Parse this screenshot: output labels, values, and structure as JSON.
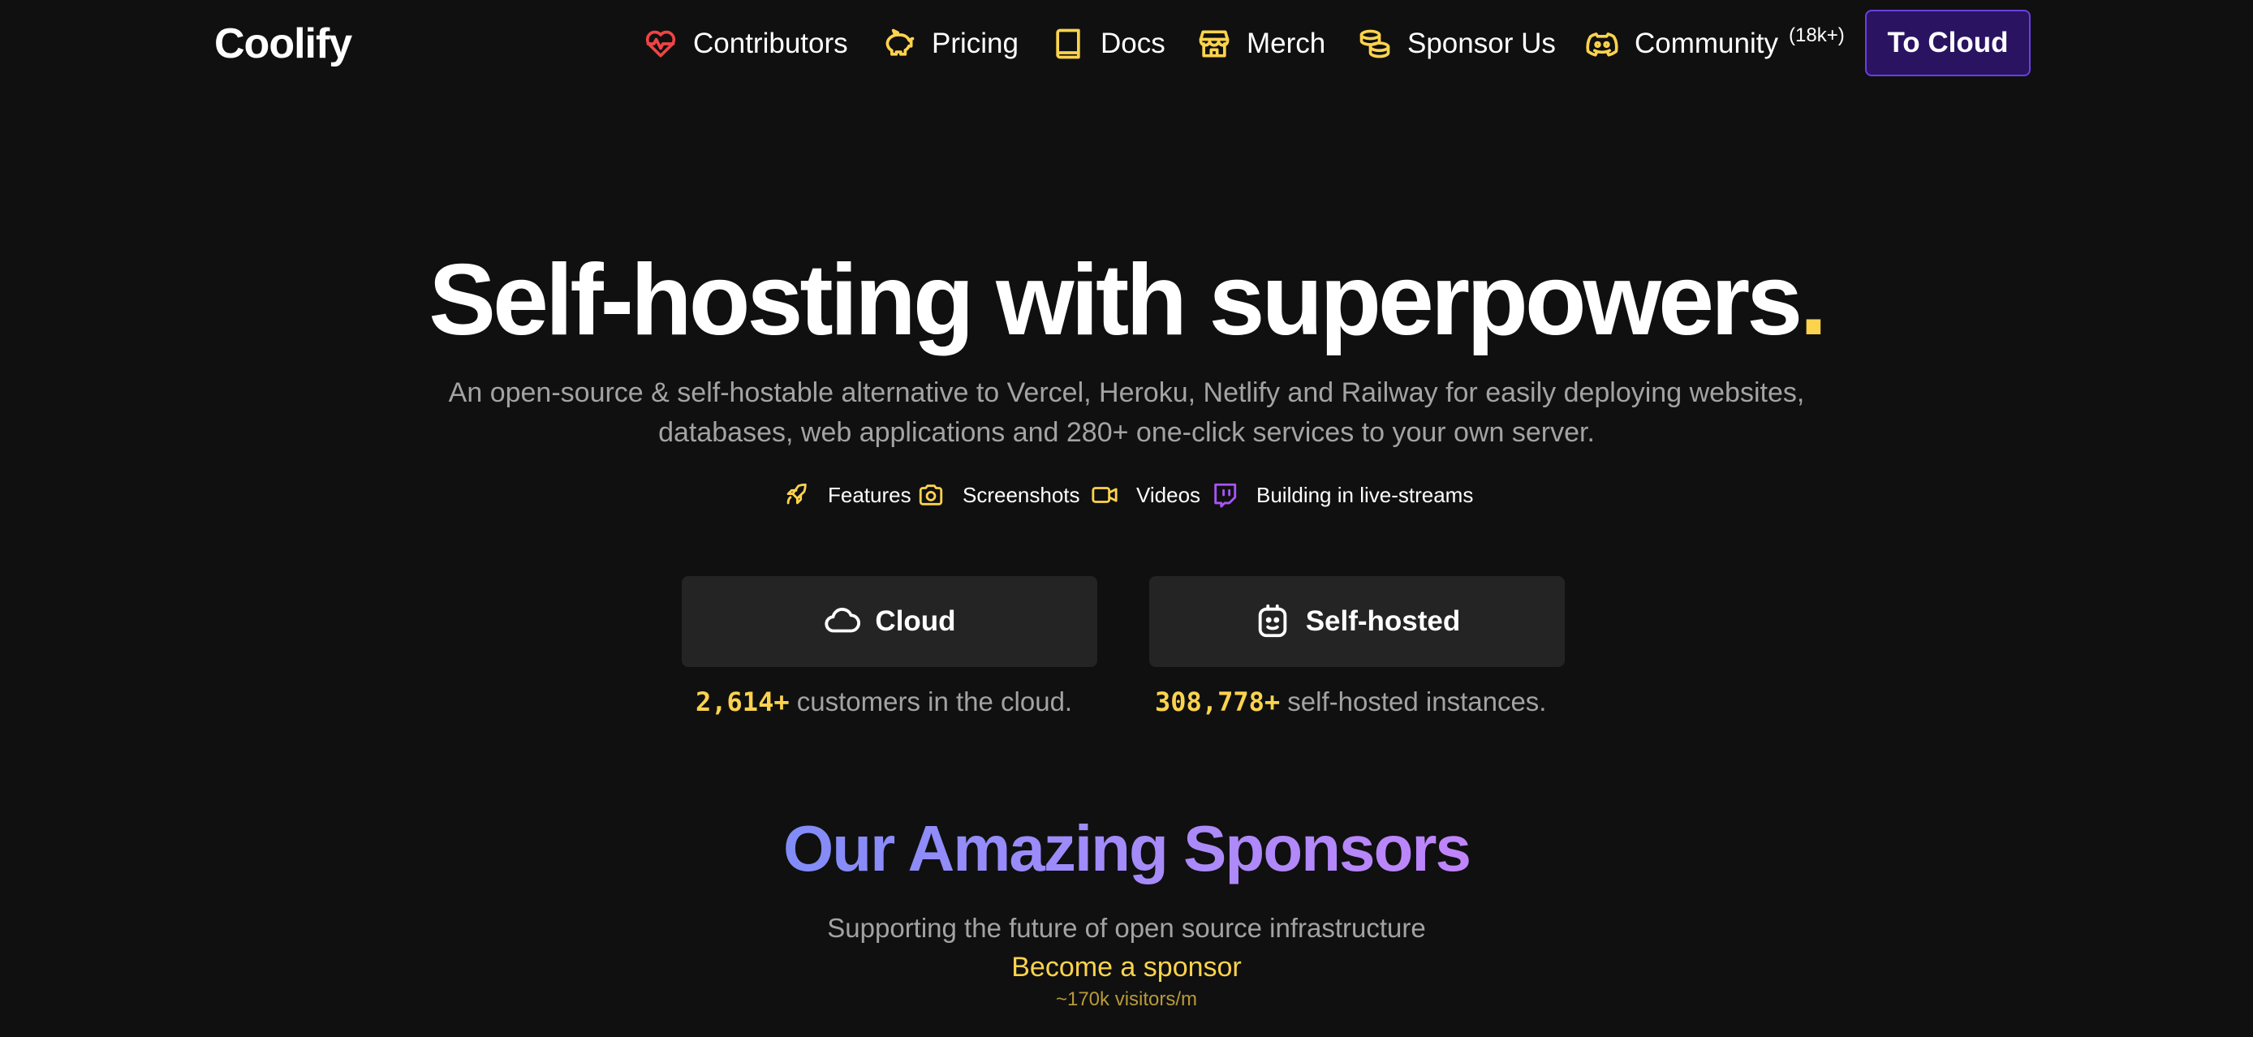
{
  "header": {
    "logo": "Coolify",
    "nav": [
      {
        "label": "Contributors",
        "icon": "heart-pulse-icon"
      },
      {
        "label": "Pricing",
        "icon": "piggy-bank-icon"
      },
      {
        "label": "Docs",
        "icon": "book-icon"
      },
      {
        "label": "Merch",
        "icon": "store-icon"
      },
      {
        "label": "Sponsor Us",
        "icon": "coins-icon"
      },
      {
        "label": "Community",
        "icon": "discord-icon",
        "badge": "(18k+)"
      }
    ],
    "cta_label": "To Cloud"
  },
  "hero": {
    "title": "Self-hosting with superpowers",
    "title_dot": ".",
    "subtitle_line1": "An open-source & self-hostable alternative to Vercel, Heroku, Netlify and Railway for easily deploying websites,",
    "subtitle_line2": "databases, web applications and 280+ one-click services to your own server.",
    "links": [
      {
        "label": "Features",
        "icon": "rocket-icon"
      },
      {
        "label": "Screenshots",
        "icon": "camera-icon"
      },
      {
        "label": "Videos",
        "icon": "video-icon"
      },
      {
        "label": "Building in live-streams",
        "icon": "twitch-icon"
      }
    ]
  },
  "options": [
    {
      "label": "Cloud",
      "icon": "cloud-icon",
      "count": "2,614+",
      "text": "customers in the cloud."
    },
    {
      "label": "Self-hosted",
      "icon": "robot-face-icon",
      "count": "308,778+",
      "text": "self-hosted instances."
    }
  ],
  "sponsors": {
    "title": "Our Amazing Sponsors",
    "subtitle": "Supporting the future of open source infrastructure",
    "link": "Become a sponsor",
    "note": "~170k visitors/m"
  },
  "colors": {
    "background": "#101010",
    "accent_yellow": "#fcd34d",
    "cloud_button": "#2a1361",
    "twitch_purple": "#a855f7",
    "heart_red": "#ef4444",
    "gradient_start": "#818cf8",
    "gradient_end": "#c084fc"
  }
}
